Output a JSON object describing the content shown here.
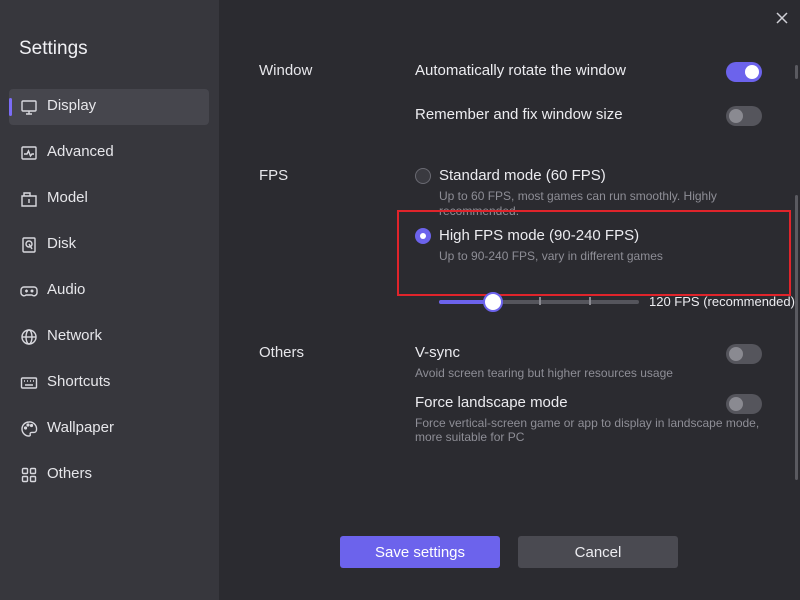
{
  "sidebar": {
    "title": "Settings",
    "items": [
      {
        "label": "Display",
        "icon": "monitor-icon",
        "active": true
      },
      {
        "label": "Advanced",
        "icon": "pulse-icon"
      },
      {
        "label": "Model",
        "icon": "model-icon"
      },
      {
        "label": "Disk",
        "icon": "disk-icon"
      },
      {
        "label": "Audio",
        "icon": "gamepad-icon"
      },
      {
        "label": "Network",
        "icon": "globe-icon"
      },
      {
        "label": "Shortcuts",
        "icon": "keyboard-icon"
      },
      {
        "label": "Wallpaper",
        "icon": "palette-icon"
      },
      {
        "label": "Others",
        "icon": "grid-icon"
      }
    ]
  },
  "window": {
    "section_label": "Window",
    "auto_rotate": {
      "label": "Automatically rotate the window",
      "enabled": true
    },
    "remember_size": {
      "label": "Remember and fix window size",
      "enabled": false
    }
  },
  "fps": {
    "section_label": "FPS",
    "standard": {
      "label": "Standard mode (60 FPS)",
      "description_line1": "Up to 60 FPS, most games can run smoothly. Highly",
      "description_line2": "recommended.",
      "selected": false
    },
    "high": {
      "label": "High FPS mode (90-240 FPS)",
      "description": "Up to 90-240 FPS, vary in different games",
      "selected": true
    },
    "slider": {
      "value_label": "120 FPS (recommended)",
      "position_fraction": 0.27
    }
  },
  "others": {
    "section_label": "Others",
    "vsync": {
      "label": "V-sync",
      "description": "Avoid screen tearing but higher resources usage",
      "enabled": false
    },
    "force_landscape": {
      "label": "Force landscape mode",
      "description_line1": "Force vertical-screen game or app to display in landscape mode,",
      "description_line2": "more suitable for PC",
      "enabled": false
    }
  },
  "buttons": {
    "save": "Save settings",
    "cancel": "Cancel"
  },
  "colors": {
    "accent": "#6c63ec",
    "highlight": "#e0242b",
    "sidebar": "#37373d",
    "background": "#2b2b30"
  }
}
